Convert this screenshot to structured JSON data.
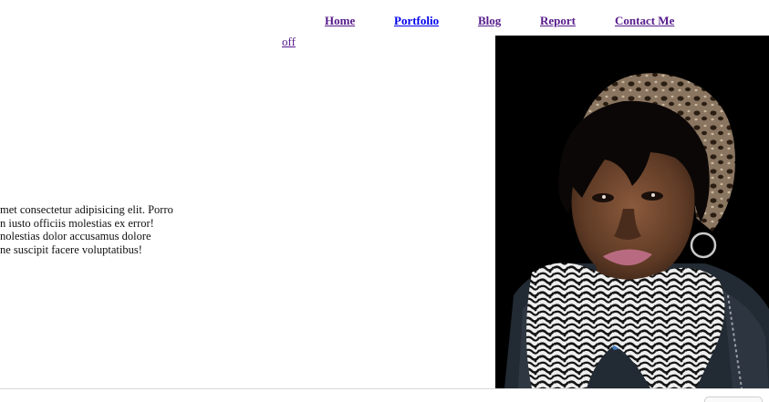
{
  "nav": {
    "items": [
      {
        "label": "Home"
      },
      {
        "label": "Portfolio"
      },
      {
        "label": "Blog"
      },
      {
        "label": "Report"
      },
      {
        "label": "Contact Me"
      }
    ]
  },
  "toggle": {
    "label": "off"
  },
  "content": {
    "lines": [
      "met consectetur adipisicing elit. Porro",
      "n iusto officiis molestias ex error!",
      "nolestias dolor accusamus dolore",
      "ne suscipit facere voluptatibus!"
    ]
  },
  "colors": {
    "visited_link": "#551a8b",
    "active_link": "#0000ee",
    "photo_background": "#000000"
  }
}
